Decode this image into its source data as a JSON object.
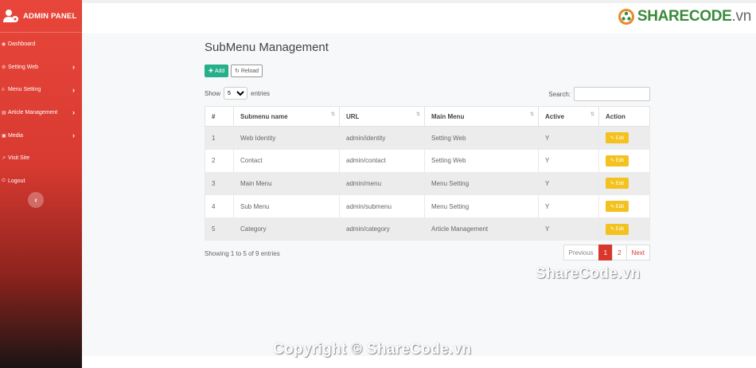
{
  "sidebar": {
    "brand": "ADMIN PANEL",
    "items": [
      {
        "label": "Dashboard",
        "icon": "dashboard-icon",
        "has_submenu": false
      },
      {
        "label": "Setting Web",
        "icon": "gear-icon",
        "has_submenu": true
      },
      {
        "label": "Menu Setting",
        "icon": "list-icon",
        "has_submenu": true
      },
      {
        "label": "Article Management",
        "icon": "article-icon",
        "has_submenu": true
      },
      {
        "label": "Media",
        "icon": "image-icon",
        "has_submenu": true
      },
      {
        "label": "Visit Site",
        "icon": "external-link-icon",
        "has_submenu": false
      },
      {
        "label": "Logout",
        "icon": "logout-icon",
        "has_submenu": false
      }
    ],
    "collapse_glyph": "‹"
  },
  "logo": {
    "brand": "SHARECODE",
    "suffix": ".vn"
  },
  "page": {
    "title": "SubMenu Management"
  },
  "toolbar": {
    "add_label": "Add",
    "reload_label": "Reload"
  },
  "length": {
    "prefix": "Show",
    "suffix": "entries",
    "selected": "5"
  },
  "search": {
    "label": "Search:",
    "value": ""
  },
  "table": {
    "columns": [
      "#",
      "Submenu name",
      "URL",
      "Main Menu",
      "Active",
      "Action"
    ],
    "rows": [
      {
        "num": "1",
        "name": "Web Identity",
        "url": "admin/identity",
        "main": "Setting Web",
        "active": "Y",
        "action": "Edit"
      },
      {
        "num": "2",
        "name": "Contact",
        "url": "admin/contact",
        "main": "Setting Web",
        "active": "Y",
        "action": "Edit"
      },
      {
        "num": "3",
        "name": "Main Menu",
        "url": "admin/menu",
        "main": "Menu Setting",
        "active": "Y",
        "action": "Edit"
      },
      {
        "num": "4",
        "name": "Sub Menu",
        "url": "admin/submenu",
        "main": "Menu Setting",
        "active": "Y",
        "action": "Edit"
      },
      {
        "num": "5",
        "name": "Category",
        "url": "admin/category",
        "main": "Article Management",
        "active": "Y",
        "action": "Edit"
      }
    ]
  },
  "info": "Showing 1 to 5 of 9 entries",
  "pagination": {
    "previous": "Previous",
    "pages": [
      "1",
      "2"
    ],
    "current": "1",
    "next": "Next"
  },
  "watermarks": {
    "middle": "ShareCode.vn",
    "bottom": "Copyright © ShareCode.vn"
  },
  "colors": {
    "sidebar_top": "#e8463a",
    "sidebar_bottom": "#1a1414",
    "add_button": "#26b08a",
    "edit_button": "#f3c21f",
    "pager_active": "#d9372c",
    "logo_green": "#3a8a3a"
  }
}
